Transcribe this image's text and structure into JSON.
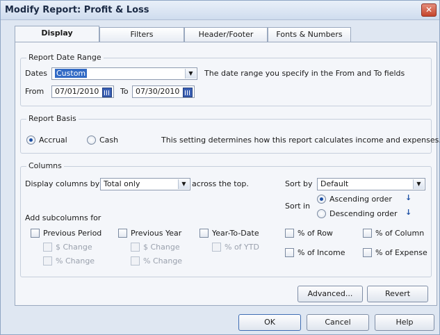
{
  "window": {
    "title": "Modify Report: Profit & Loss",
    "close_symbol": "✕"
  },
  "tabs": [
    "Display",
    "Filters",
    "Header/Footer",
    "Fonts & Numbers"
  ],
  "date_range": {
    "legend": "Report Date Range",
    "dates_label": "Dates",
    "dates_value": "Custom",
    "hint": "The date range you specify in the From and To fields",
    "from_label": "From",
    "from_value": "07/01/2010",
    "to_label": "To",
    "to_value": "07/30/2010"
  },
  "basis": {
    "legend": "Report Basis",
    "accrual": "Accrual",
    "cash": "Cash",
    "selected": "accrual",
    "hint": "This setting determines how this report calculates income and expenses."
  },
  "columns": {
    "legend": "Columns",
    "display_label": "Display columns by",
    "display_value": "Total only",
    "across": "across the top.",
    "sort_by_label": "Sort by",
    "sort_by_value": "Default",
    "sort_in_label": "Sort in",
    "ascending": "Ascending order",
    "descending": "Descending order",
    "sort_selected": "ascending",
    "add_sub_label": "Add subcolumns for",
    "prev_period": "Previous Period",
    "prev_year": "Previous Year",
    "ytd": "Year-To-Date",
    "dollar_change": "$ Change",
    "pct_change": "% Change",
    "pct_ytd": "% of YTD",
    "pct_row": "% of Row",
    "pct_column": "% of Column",
    "pct_income": "% of Income",
    "pct_expense": "% of Expense"
  },
  "buttons": {
    "advanced": "Advanced...",
    "revert": "Revert",
    "ok": "OK",
    "cancel": "Cancel",
    "help": "Help"
  }
}
